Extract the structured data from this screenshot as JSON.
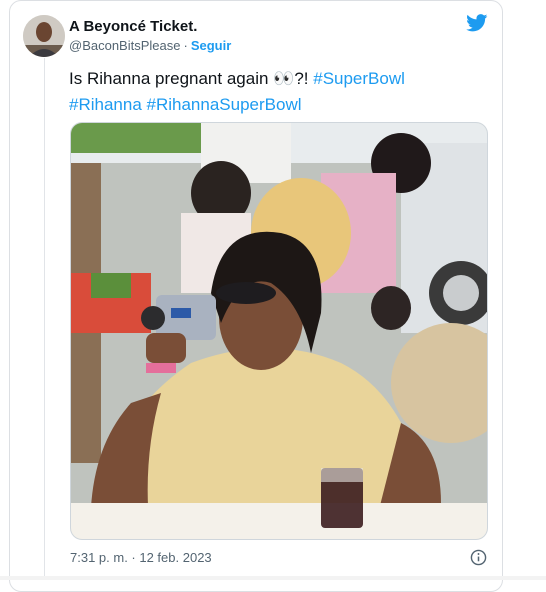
{
  "author": {
    "name": "A Beyoncé Ticket.",
    "handle": "@BaconBitsPlease",
    "separator": "·",
    "follow_label": "Seguir"
  },
  "tweet": {
    "text_prefix": "Is Rihanna pregnant again ",
    "emoji": "👀",
    "text_suffix": "?! ",
    "hashtags": [
      "#SuperBowl",
      "#Rihanna",
      "#RihannaSuperBowl"
    ]
  },
  "timestamp": "7:31 p. m. · 12 feb. 2023",
  "icons": {
    "brand": "twitter-bird-icon",
    "info": "info-icon"
  },
  "colors": {
    "accent": "#1d9bf0",
    "text": "#0f1419",
    "muted": "#536471"
  }
}
